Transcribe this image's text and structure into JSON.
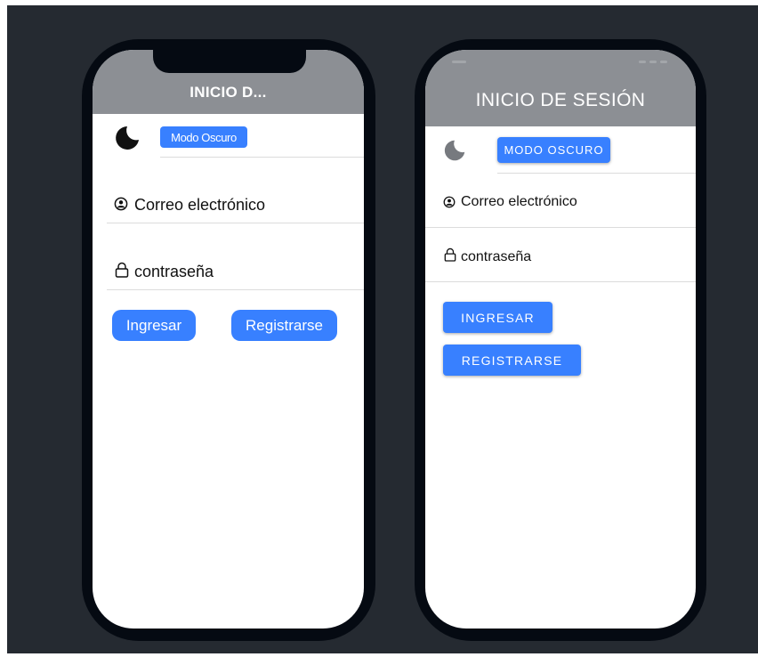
{
  "ios": {
    "title": "INICIO D...",
    "dark_mode_label": "Modo Oscuro",
    "email_placeholder": "Correo electrónico",
    "password_placeholder": "contraseña",
    "login_label": "Ingresar",
    "register_label": "Registrarse"
  },
  "android": {
    "title": "INICIO DE SESIÓN",
    "dark_mode_label": "MODO OSCURO",
    "email_placeholder": "Correo electrónico",
    "password_placeholder": "contraseña",
    "login_label": "INGRESAR",
    "register_label": "REGISTRARSE"
  },
  "icons": [
    "moon-icon",
    "person-circle-icon",
    "lock-icon"
  ],
  "colors": {
    "accent": "#3880ff",
    "header": "#8c8f94",
    "background": "#252a31",
    "phone_frame": "#050a12"
  }
}
